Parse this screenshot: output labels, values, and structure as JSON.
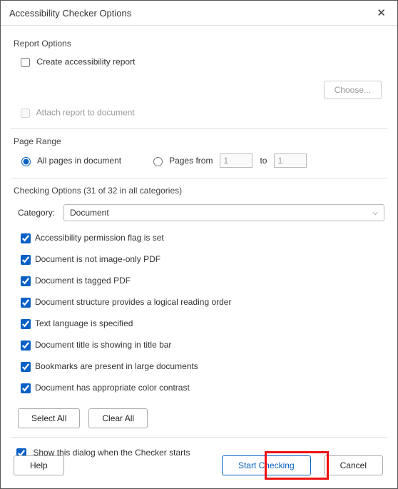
{
  "title": "Accessibility Checker Options",
  "groups": {
    "report": "Report Options",
    "page": "Page Range",
    "checking": "Checking Options (31 of 32 in all categories)"
  },
  "report": {
    "create_label": "Create accessibility report",
    "create_checked": false,
    "choose_label": "Choose...",
    "attach_label": "Attach report to document",
    "attach_checked": false
  },
  "page": {
    "all_label": "All pages in document",
    "from_label": "Pages from",
    "from_value": "1",
    "to_label": "to",
    "to_value": "1",
    "selected": "all"
  },
  "category": {
    "label": "Category:",
    "value": "Document"
  },
  "options": [
    {
      "label": "Accessibility permission flag is set",
      "checked": true
    },
    {
      "label": "Document is not image-only PDF",
      "checked": true
    },
    {
      "label": "Document is tagged PDF",
      "checked": true
    },
    {
      "label": "Document structure provides a logical reading order",
      "checked": true
    },
    {
      "label": "Text language is specified",
      "checked": true
    },
    {
      "label": "Document title is showing in title bar",
      "checked": true
    },
    {
      "label": "Bookmarks are present in large documents",
      "checked": true
    },
    {
      "label": "Document has appropriate color contrast",
      "checked": true
    }
  ],
  "buttons": {
    "select_all": "Select All",
    "clear_all": "Clear All",
    "help": "Help",
    "start": "Start Checking",
    "cancel": "Cancel"
  },
  "show_dialog": {
    "label": "Show this dialog when the Checker starts",
    "checked": true
  }
}
